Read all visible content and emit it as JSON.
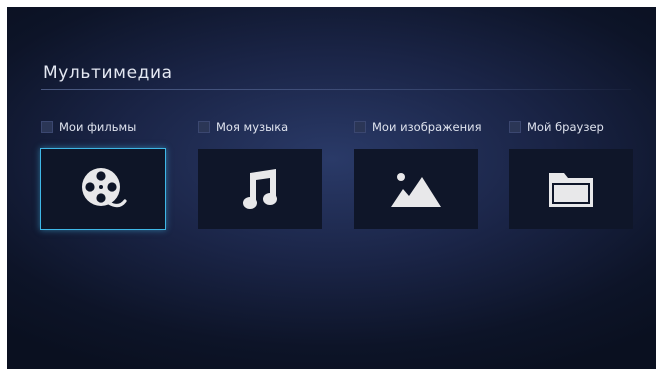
{
  "page": {
    "title": "Мультимедиа"
  },
  "items": [
    {
      "label": "Мои фильмы",
      "icon": "film-reel-icon",
      "selected": true
    },
    {
      "label": "Моя музыка",
      "icon": "music-note-icon",
      "selected": false
    },
    {
      "label": "Мои изображения",
      "icon": "image-icon",
      "selected": false
    },
    {
      "label": "Мой браузер",
      "icon": "folder-icon",
      "selected": false
    }
  ],
  "colors": {
    "focus_border": "#3fb7e6",
    "icon": "#e8e8ea",
    "tile": "#0f1629"
  }
}
